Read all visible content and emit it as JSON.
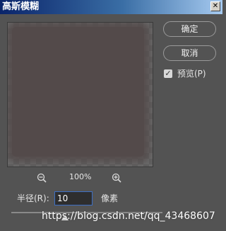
{
  "window": {
    "title": "高斯模糊",
    "close_glyph": "✕"
  },
  "buttons": {
    "ok_label": "确定",
    "cancel_label": "取消"
  },
  "preview_option": {
    "label": "预览(P)",
    "checked": true,
    "check_glyph": "✓"
  },
  "zoom": {
    "level": "100%"
  },
  "radius": {
    "label": "半径(R):",
    "value": "10",
    "unit": "像素"
  },
  "watermark": {
    "text": "https://blog.csdn.net/qq_43468607"
  },
  "colors": {
    "dialog_bg": "#535353",
    "title_gradient_start": "#0a246a",
    "input_border": "#3d6fc4"
  }
}
